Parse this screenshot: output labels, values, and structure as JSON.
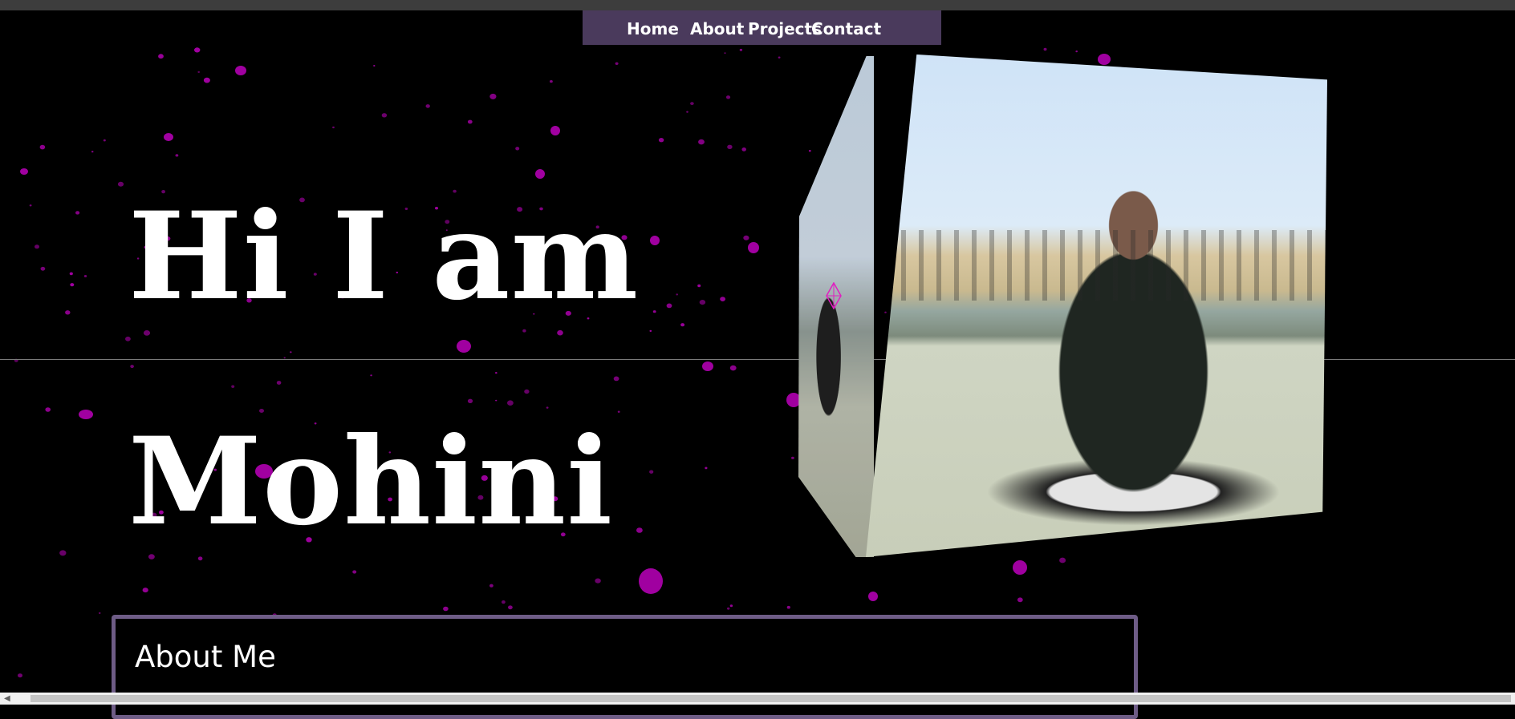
{
  "nav": {
    "items": [
      "Home",
      "About",
      "Projects",
      "Contact"
    ]
  },
  "hero": {
    "line1": "Hi I am",
    "line2": "Mohini"
  },
  "about": {
    "title": "About Me",
    "text": ""
  },
  "colors": {
    "background": "#000000",
    "nav_background": "#4a3a5c",
    "particle": "#a000a0",
    "about_border": "#6e5c86"
  },
  "icons": {
    "cursor": "move-cursor-icon",
    "scroll_left": "scroll-left-arrow-icon"
  }
}
